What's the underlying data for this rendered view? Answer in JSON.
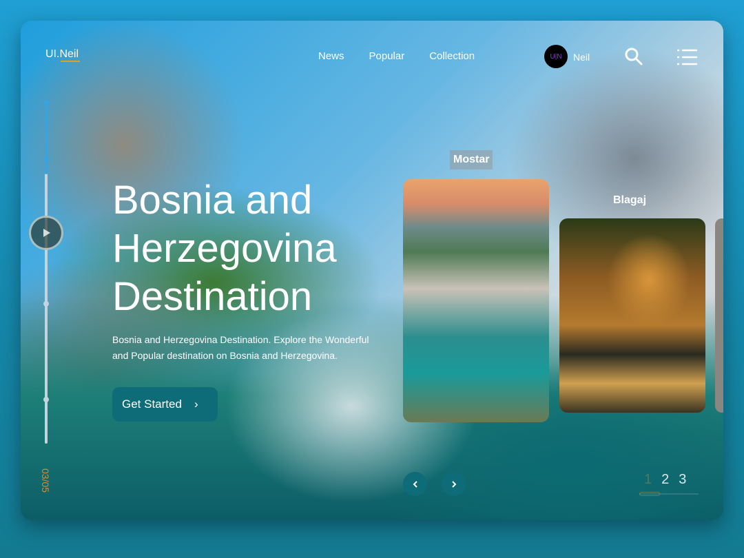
{
  "header": {
    "logo": "UI.Neil",
    "nav": [
      "News",
      "Popular",
      "Collection"
    ],
    "avatar_initials": "U|N",
    "user_name": "Neil"
  },
  "timeline": {
    "counter": "03/05",
    "progress": 0.21
  },
  "hero": {
    "title": "Bosnia and Herzegovina Destination",
    "description": "Bosnia and Herzegovina Destination. Explore the Wonderful and Popular destination on Bosnia and Herzegovina.",
    "cta": "Get Started"
  },
  "destinations": [
    {
      "name": "Mostar"
    },
    {
      "name": "Blagaj"
    }
  ],
  "pagination": {
    "pages": [
      "1",
      "2",
      "3"
    ],
    "active": "1"
  },
  "colors": {
    "accent": "#0e6b78",
    "timeline": "#3aa2dc",
    "logo_underline": "#e0a020"
  }
}
